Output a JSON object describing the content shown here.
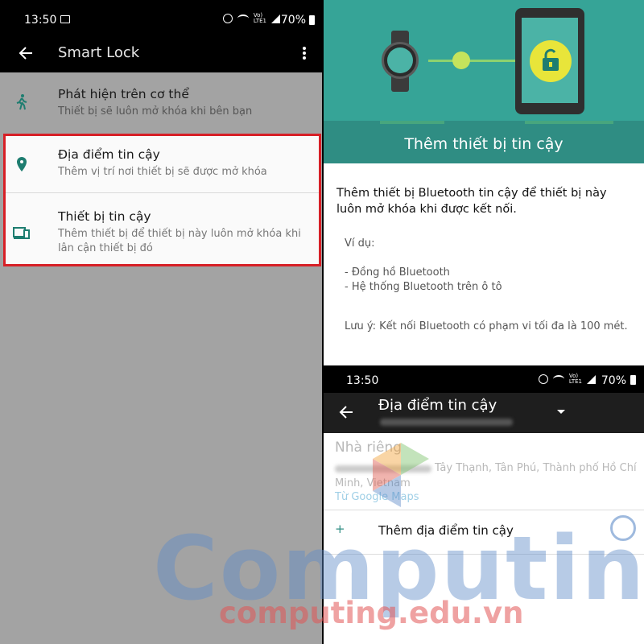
{
  "left": {
    "status": {
      "time": "13:50",
      "network": "Vo)\nLTE1",
      "battery": "70%"
    },
    "toolbar": {
      "title": "Smart Lock"
    },
    "items": [
      {
        "title": "Phát hiện trên cơ thể",
        "subtitle": "Thiết bị sẽ luôn mở khóa khi bên bạn",
        "icon": "walking-person-icon"
      },
      {
        "title": "Địa điểm tin cậy",
        "subtitle": "Thêm vị trí nơi thiết bị sẽ được mở khóa",
        "icon": "location-pin-icon"
      },
      {
        "title": "Thiết bị tin cậy",
        "subtitle": "Thêm thiết bị để thiết bị này luôn mở khóa khi lân cận thiết bị đó",
        "icon": "devices-icon"
      }
    ],
    "highlight_color": "#d71f26"
  },
  "right_top": {
    "hero_title": "Thêm thiết bị tin cậy",
    "description": "Thêm thiết bị Bluetooth tin cậy để thiết bị này luôn mở khóa khi được kết nối.",
    "example_label": "Ví dụ:",
    "examples": [
      "- Đồng hồ Bluetooth",
      "- Hệ thống Bluetooth trên ô tô"
    ],
    "note": "Lưu ý: Kết nối Bluetooth có phạm vi tối đa là 100 mét.",
    "accent": "#2f8d83"
  },
  "right_bottom": {
    "status": {
      "time": "13:50",
      "network": "Vo)\nLTE1",
      "battery": "70%"
    },
    "toolbar": {
      "title": "Địa điểm tin cậy"
    },
    "home": {
      "title": "Nhà riêng",
      "address": "Tây Thạnh, Tân Phú, Thành phố Hồ Chí Minh, Vietnam",
      "source": "Từ Google Maps"
    },
    "add": {
      "plus": "+",
      "label": "Thêm địa điểm tin cậy"
    }
  },
  "watermark": {
    "big": "Computing",
    "small": "computing.edu.vn"
  }
}
